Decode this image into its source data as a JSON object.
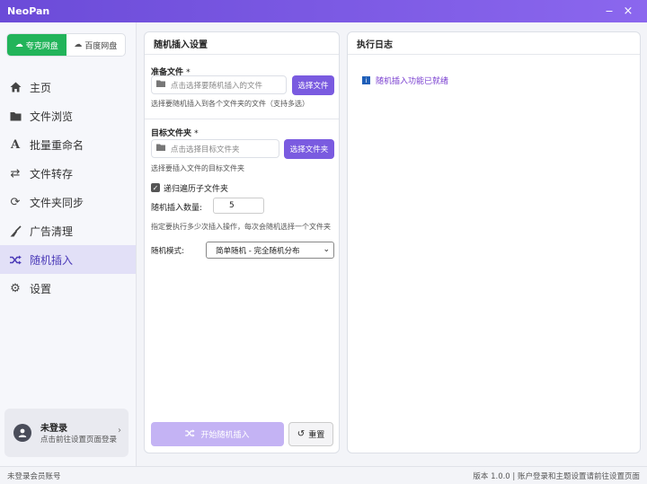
{
  "app": {
    "title": "NeoPan",
    "minimize": "‒",
    "close": "×"
  },
  "sidebar": {
    "disks": [
      {
        "label": "夸克网盘",
        "active": true
      },
      {
        "label": "百度网盘",
        "active": false
      }
    ],
    "items": [
      {
        "label": "主页",
        "icon": "home-icon"
      },
      {
        "label": "文件浏览",
        "icon": "folder-icon"
      },
      {
        "label": "批量重命名",
        "icon": "font-icon"
      },
      {
        "label": "文件转存",
        "icon": "transfer-icon"
      },
      {
        "label": "文件夹同步",
        "icon": "sync-icon"
      },
      {
        "label": "广告清理",
        "icon": "broom-icon"
      },
      {
        "label": "随机插入",
        "icon": "shuffle-icon"
      },
      {
        "label": "设置",
        "icon": "gear-icon"
      }
    ],
    "active_index": 6,
    "user": {
      "name": "未登录",
      "sub": "点击前往设置页面登录"
    }
  },
  "settings": {
    "title": "随机插入设置",
    "source_label": "准备文件",
    "required_mark": "*",
    "source_placeholder": "点击选择要随机插入的文件",
    "source_button": "选择文件",
    "source_hint": "选择要随机插入到各个文件夹的文件（支持多选）",
    "target_label": "目标文件夹",
    "target_placeholder": "点击选择目标文件夹",
    "target_button": "选择文件夹",
    "target_hint": "选择要插入文件的目标文件夹",
    "recursive_label": "递归遍历子文件夹",
    "recursive_checked": true,
    "count_label": "随机插入数量:",
    "count_value": "5",
    "count_hint": "指定要执行多少次插入操作，每次会随机选择一个文件夹",
    "mode_label": "随机模式:",
    "mode_value": "简单随机 - 完全随机分布",
    "start_button": "开始随机插入",
    "reset_button": "重置"
  },
  "log": {
    "title": "执行日志",
    "lines": [
      "随机插入功能已就绪"
    ]
  },
  "status": {
    "left": "未登录会员账号",
    "right": "版本 1.0.0 | 账户登录和主题设置请前往设置页面"
  },
  "colors": {
    "accent": "#7a5be0",
    "quark_green": "#22b45a",
    "title_bar": "#6b4bd8"
  }
}
